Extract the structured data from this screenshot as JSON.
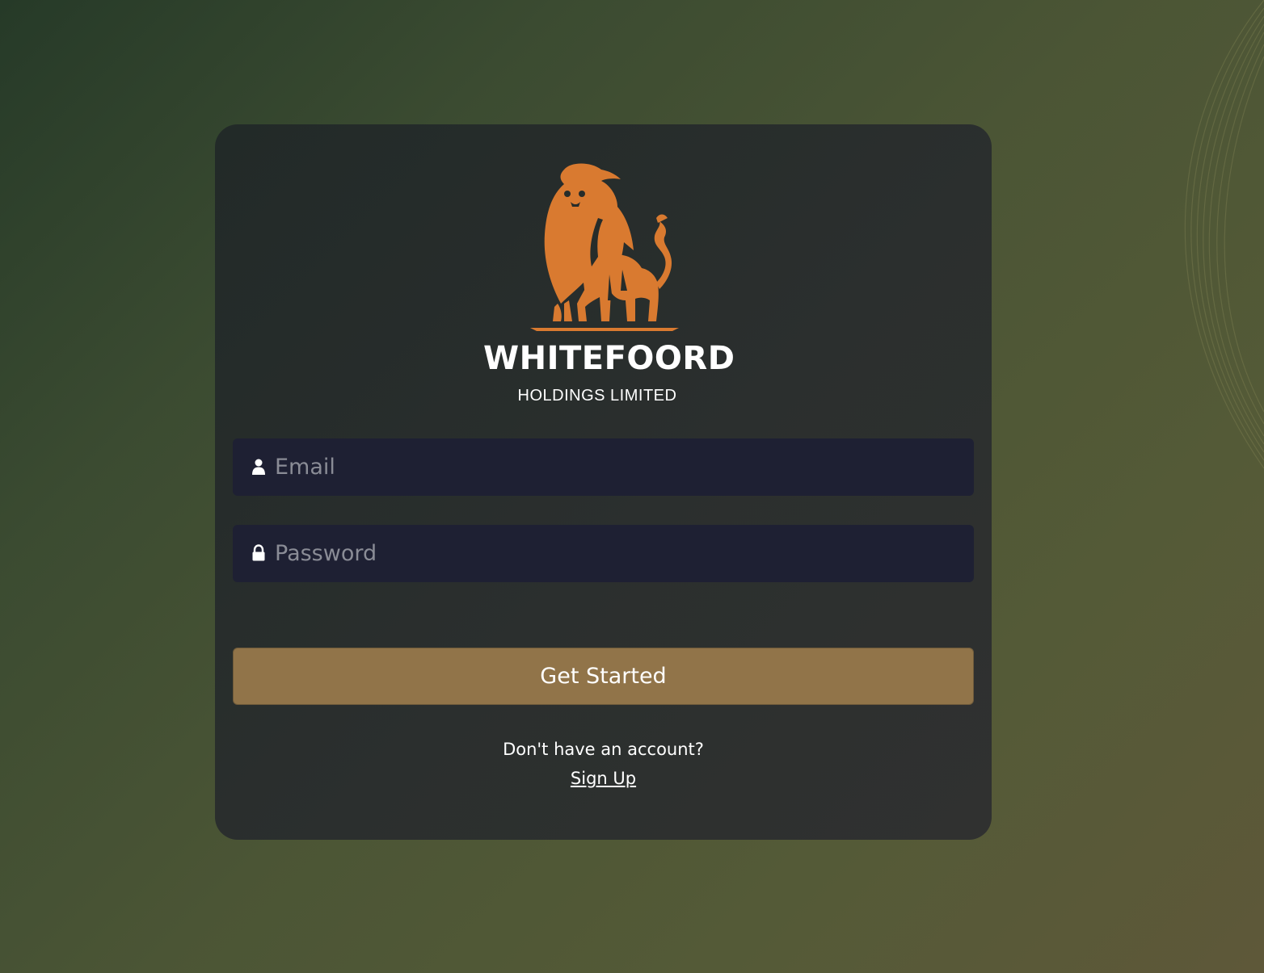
{
  "brand": {
    "name": "WHITEFOORD",
    "subtitle": "HOLDINGS LIMITED",
    "logo_icon": "lion-logo-icon",
    "logo_color": "#d97a30"
  },
  "form": {
    "email": {
      "placeholder": "Email",
      "value": "",
      "icon": "user-icon"
    },
    "password": {
      "placeholder": "Password",
      "value": "",
      "icon": "lock-icon"
    },
    "submit_label": "Get Started"
  },
  "signup": {
    "prompt": "Don't have an account?",
    "link_label": "Sign Up"
  },
  "colors": {
    "card_bg": "#2b2f2e",
    "input_bg": "#1e2033",
    "button_bg": "#917449",
    "accent": "#d97a30"
  }
}
